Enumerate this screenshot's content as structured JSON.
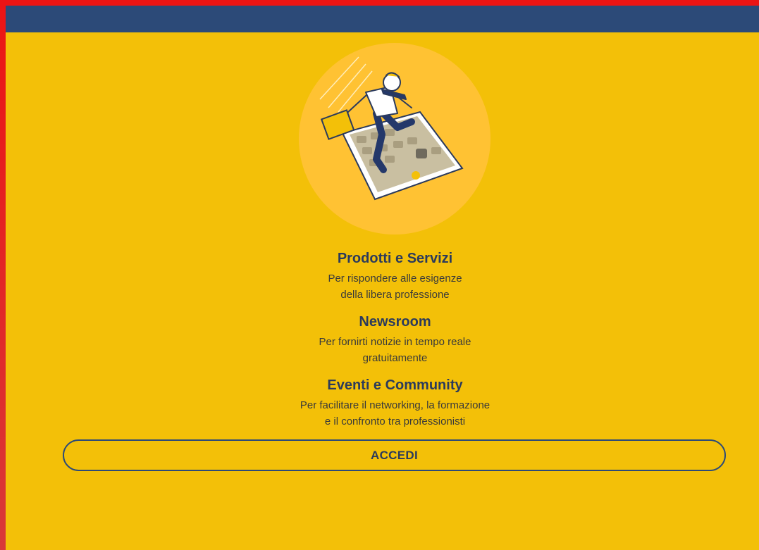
{
  "hero": {
    "illustration": "man-jumping-onto-smartphone-illustration"
  },
  "sections": [
    {
      "title": "Prodotti e Servizi",
      "line1": "Per rispondere alle esigenze",
      "line2": "della libera professione"
    },
    {
      "title": "Newsroom",
      "line1": "Per fornirti notizie in tempo reale",
      "line2": "gratuitamente"
    },
    {
      "title": "Eventi e Community",
      "line1": "Per facilitare il networking, la formazione",
      "line2": "e il confronto tra professionisti"
    }
  ],
  "login": {
    "label": "ACCEDI"
  },
  "colors": {
    "background": "#f3c008",
    "header": "#2c4a78",
    "text": "#2b3a5c",
    "frame": "#ec1414"
  }
}
